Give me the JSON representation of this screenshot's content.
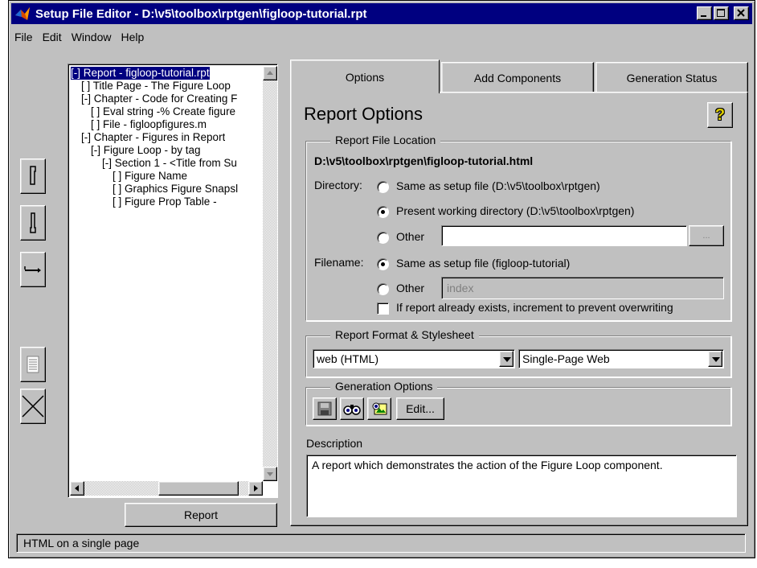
{
  "window": {
    "title": "Setup File Editor - D:\\v5\\toolbox\\rptgen\\figloop-tutorial.rpt"
  },
  "menu": {
    "items": [
      "File",
      "Edit",
      "Window",
      "Help"
    ]
  },
  "tree": {
    "items": [
      "[-] Report - figloop-tutorial.rpt",
      "[ ] Title Page - The Figure Loop",
      "[-] Chapter - Code for Creating F",
      "[ ] Eval string -% Create figure",
      "[ ] File - figloopfigures.m",
      "[-] Chapter - Figures in Report",
      "[-] Figure Loop - by tag",
      "[-] Section 1 - <Title from Su",
      "[ ] Figure Name",
      "[ ] Graphics Figure Snapsl",
      "[ ] Figure Prop Table -"
    ]
  },
  "report_button": "Report",
  "tabs": [
    "Options",
    "Add Components",
    "Generation Status"
  ],
  "panel": {
    "heading": "Report Options",
    "help_glyph": "?",
    "file_location": {
      "title": "Report File Location",
      "path": "D:\\v5\\toolbox\\rptgen\\figloop-tutorial.html",
      "directory_label": "Directory:",
      "dir_opt_setup": "Same as setup file (D:\\v5\\toolbox\\rptgen)",
      "dir_opt_pwd": "Present working directory (D:\\v5\\toolbox\\rptgen)",
      "dir_opt_other": "Other",
      "browse": "...",
      "filename_label": "Filename:",
      "fn_opt_setup": "Same as setup file (figloop-tutorial)",
      "fn_opt_other": "Other",
      "fn_other_value": "index",
      "increment_label": "If report already exists, increment to prevent overwriting"
    },
    "format": {
      "title": "Report Format & Stylesheet",
      "format_value": "web (HTML)",
      "stylesheet_value": "Single-Page Web"
    },
    "generation": {
      "title": "Generation Options",
      "edit_label": "Edit..."
    },
    "description": {
      "label": "Description",
      "text": "A report which demonstrates the action of the Figure Loop component."
    }
  },
  "status": "HTML on a single page"
}
